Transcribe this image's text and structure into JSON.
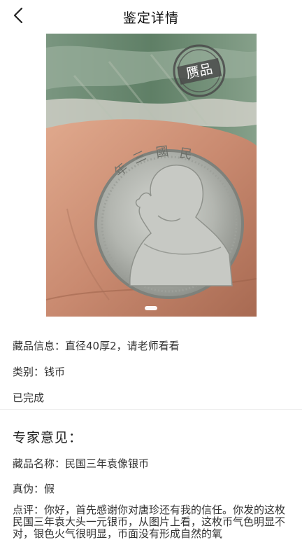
{
  "nav": {
    "title": "鉴定详情",
    "back_icon": "chevron-left-icon"
  },
  "photo": {
    "stamp_text": "赝品",
    "coin_legend": "年三國民華中",
    "page_indicator": "1"
  },
  "item_info": {
    "info": "藏品信息：直径40厚2，请老师看看",
    "category": "类别：钱币",
    "status": "已完成"
  },
  "expert": {
    "section_title": "专家意见：",
    "name": "藏品名称：民国三年袁像银币",
    "authenticity": "真伪：假",
    "comment": "点评：你好，首先感谢你对唐珍还有我的信任。你发的这枚民国三年袁大头一元银币，从图片上看，这枚币气色明显不对，银色火气很明显，币面没有形成自然的氧"
  },
  "colors": {
    "stamp": "#4a4a4a",
    "coin": "#b9bbb6",
    "skin": "#c89078",
    "cloth_green": "#6f8f74"
  }
}
